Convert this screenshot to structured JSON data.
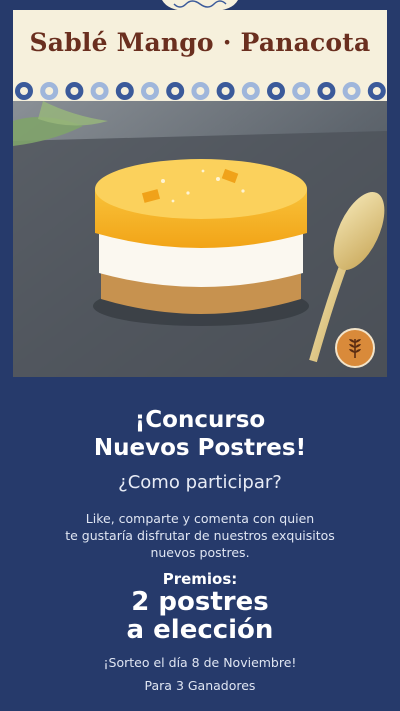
{
  "header": {
    "title": "Sablé Mango · Panacota"
  },
  "photo": {
    "subject": "dessert-photo",
    "badge_icon": "wheat-icon"
  },
  "promo": {
    "headline_line1": "¡Concurso",
    "headline_line2": "Nuevos Postres!",
    "subheadline": "¿Como participar?",
    "body_line1": "Like, comparte y comenta con quien",
    "body_line2": "te gustaría disfrutar de nuestros exquisitos",
    "body_line3": "nuevos postres.",
    "prize_label": "Premios:",
    "prize_line1": "2 postres",
    "prize_line2": "a elección",
    "draw_date": "¡Sorteo el día 8 de Noviembre!",
    "winners": "Para 3 Ganadores"
  },
  "colors": {
    "navy": "#263a6b",
    "cream": "#f6f0dc",
    "title_brown": "#6a2f1f",
    "tile_blue": "#3b5a9a",
    "badge_orange": "#d98a3a"
  }
}
